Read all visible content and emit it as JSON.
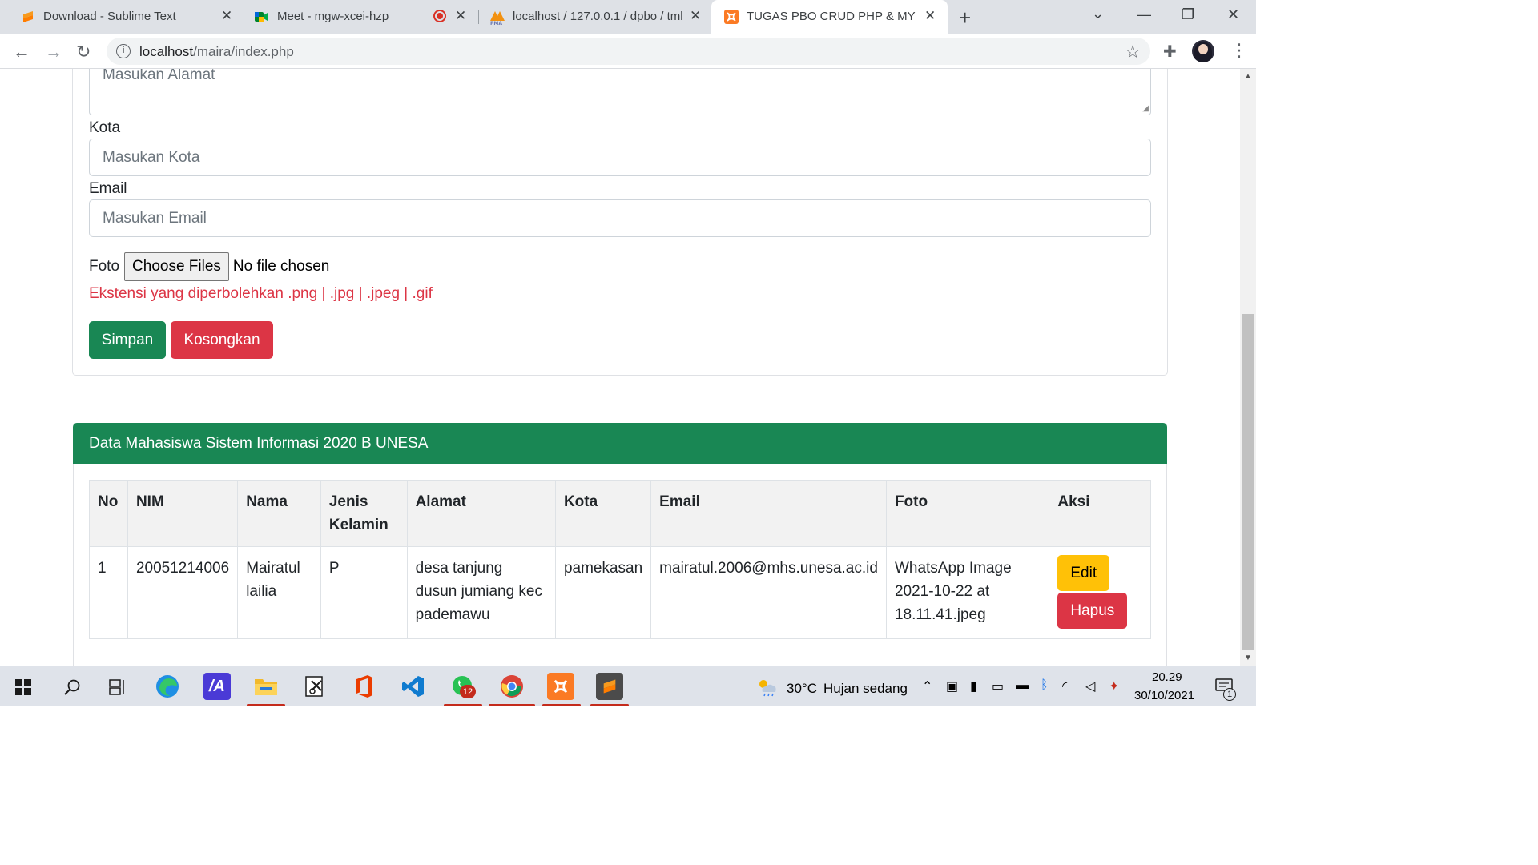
{
  "browser": {
    "tabs": [
      {
        "label": "Download - Sublime Text",
        "favicon": "sublime-icon",
        "active": false
      },
      {
        "label": "Meet - mgw-xcei-hzp",
        "favicon": "google-meet-icon",
        "active": false,
        "recording": true
      },
      {
        "label": "localhost / 127.0.0.1 / dpbo / tml",
        "favicon": "phpmyadmin-icon",
        "active": false
      },
      {
        "label": "TUGAS PBO CRUD PHP & MY SQL",
        "favicon": "xampp-icon",
        "active": true
      }
    ],
    "url_host": "localhost",
    "url_path": "/maira/index.php"
  },
  "form": {
    "alamat_placeholder": "Masukan Alamat",
    "kota_label": "Kota",
    "kota_placeholder": "Masukan Kota",
    "email_label": "Email",
    "email_placeholder": "Masukan Email",
    "foto_label": "Foto",
    "file_button": "Choose Files",
    "file_status": "No file chosen",
    "hint": "Ekstensi yang diperbolehkan .png | .jpg | .jpeg | .gif",
    "save_label": "Simpan",
    "reset_label": "Kosongkan"
  },
  "table": {
    "title": "Data Mahasiswa Sistem Informasi 2020 B UNESA",
    "columns": [
      "No",
      "NIM",
      "Nama",
      "Jenis Kelamin",
      "Alamat",
      "Kota",
      "Email",
      "Foto",
      "Aksi"
    ],
    "rows": [
      {
        "no": "1",
        "nim": "20051214006",
        "nama": "Mairatul lailia",
        "jk": "P",
        "alamat": "desa tanjung dusun jumiang kec pademawu",
        "kota": "pamekasan",
        "email": "mairatul.2006@mhs.unesa.ac.id",
        "foto": "WhatsApp Image 2021-10-22 at 18.11.41.jpeg",
        "edit_label": "Edit",
        "delete_label": "Hapus"
      }
    ]
  },
  "taskbar": {
    "weather_temp": "30°C",
    "weather_desc": "Hujan sedang",
    "time": "20.29",
    "date": "30/10/2021",
    "whatsapp_badge": "12",
    "notification_count": "1"
  },
  "colors": {
    "primary_green": "#198754",
    "danger_red": "#dc3545",
    "warning_yellow": "#ffc107"
  }
}
